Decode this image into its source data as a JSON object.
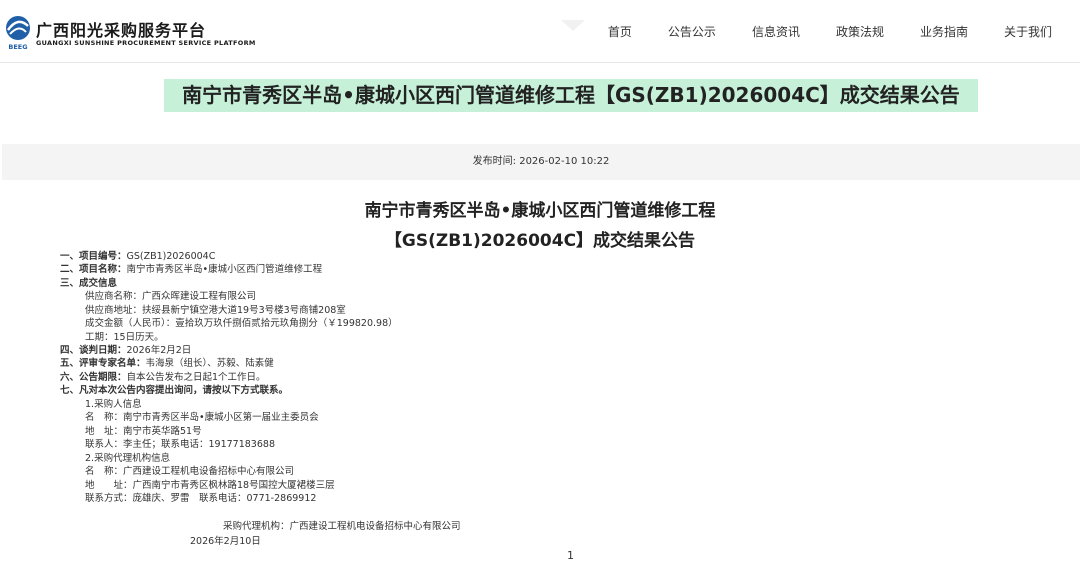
{
  "brand": {
    "title": "广西阳光采购服务平台",
    "subtitle": "GUANGXI SUNSHINE PROCUREMENT SERVICE PLATFORM",
    "logo_text": "BEEG"
  },
  "nav": [
    "首页",
    "公告公示",
    "信息资讯",
    "政策法规",
    "业务指南",
    "关于我们"
  ],
  "page_title": "南宁市青秀区半岛•康城小区西门管道维修工程【GS(ZB1)2026004C】成交结果公告",
  "publish_time": "发布时间: 2026-02-10 10:22",
  "doc": {
    "title_line1": "南宁市青秀区半岛•康城小区西门管道维修工程",
    "title_line2": "【GS(ZB1)2026004C】成交结果公告",
    "lines": [
      {
        "label": "一、项目编号：",
        "value": "GS(ZB1)2026004C"
      },
      {
        "label": "二、项目名称：",
        "value": "南宁市青秀区半岛•康城小区西门管道维修工程"
      },
      {
        "label": "三、成交信息",
        "value": ""
      },
      {
        "label": "",
        "value": "供应商名称：广西众晖建设工程有限公司"
      },
      {
        "label": "",
        "value": "供应商地址：扶绥县新宁镇空港大道19号3号楼3号商铺208室"
      },
      {
        "label": "",
        "value": "成交金额（人民币）：壹拾玖万玖仟捌佰贰拾元玖角捌分（￥199820.98）"
      },
      {
        "label": "",
        "value": "工期：15日历天。"
      },
      {
        "label": "四、谈判日期：",
        "value": "2026年2月2日"
      },
      {
        "label": "五、评审专家名单：",
        "value": "韦海泉（组长）、苏毅、陆素健"
      },
      {
        "label": "六、公告期限：",
        "value": "自本公告发布之日起1个工作日。"
      },
      {
        "label": "七、凡对本次公告内容提出询问，请按以下方式联系。",
        "value": ""
      },
      {
        "label": "",
        "value": "1.采购人信息"
      },
      {
        "label": "",
        "value": "名　称：南宁市青秀区半岛•康城小区第一届业主委员会"
      },
      {
        "label": "",
        "value": "地　址：南宁市英华路51号"
      },
      {
        "label": "",
        "value": "联系人：李主任；联系电话：19177183688"
      },
      {
        "label": "",
        "value": "2.采购代理机构信息"
      },
      {
        "label": "",
        "value": "名　称：广西建设工程机电设备招标中心有限公司"
      },
      {
        "label": "",
        "value": "地　　址：广西南宁市青秀区枫林路18号国控大厦裙楼三层"
      },
      {
        "label": "",
        "value": "联系方式：庞雄庆、罗雷　联系电话：0771-2869912"
      }
    ],
    "agency_sign": "采购代理机构：广西建设工程机电设备招标中心有限公司",
    "sign_date": "2026年2月10日",
    "page_number": "1"
  }
}
